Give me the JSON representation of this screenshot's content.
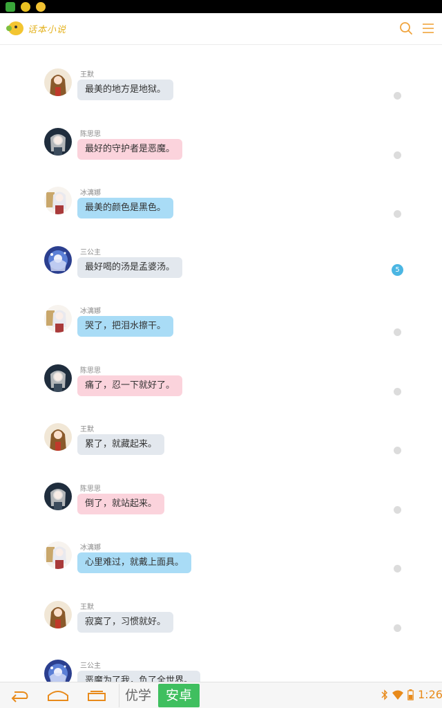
{
  "app": {
    "logo_text": "话本小说",
    "accent_color": "#f0a33b"
  },
  "header": {
    "icons": [
      "search-icon",
      "menu-icon"
    ]
  },
  "messages": [
    {
      "name": "王默",
      "text": "最美的地方是地狱。",
      "bubble_color": "gray",
      "avatar": "wangmo"
    },
    {
      "name": "陈思思",
      "text": "最好的守护者是恶魔。",
      "bubble_color": "pink",
      "avatar": "chensisi"
    },
    {
      "name": "冰漓娜",
      "text": "最美的颜色是黑色。",
      "bubble_color": "blue",
      "avatar": "binglina"
    },
    {
      "name": "三公主",
      "text": "最好喝的汤是孟婆汤。",
      "bubble_color": "gray",
      "avatar": "sangongzhu",
      "badge": "5"
    },
    {
      "name": "冰漓娜",
      "text": "哭了，把泪水擦干。",
      "bubble_color": "blue",
      "avatar": "binglina"
    },
    {
      "name": "陈思思",
      "text": "痛了，忍一下就好了。",
      "bubble_color": "pink",
      "avatar": "chensisi"
    },
    {
      "name": "王默",
      "text": "累了，就藏起来。",
      "bubble_color": "gray",
      "avatar": "wangmo"
    },
    {
      "name": "陈思思",
      "text": "倒了，就站起来。",
      "bubble_color": "pink",
      "avatar": "chensisi"
    },
    {
      "name": "冰漓娜",
      "text": "心里难过，就戴上面具。",
      "bubble_color": "blue",
      "avatar": "binglina"
    },
    {
      "name": "王默",
      "text": "寂寞了，习惯就好。",
      "bubble_color": "gray",
      "avatar": "wangmo"
    },
    {
      "name": "三公主",
      "text": "恶魔为了我，负了全世界。",
      "bubble_color": "gray",
      "avatar": "sangongzhu"
    }
  ],
  "navbar": {
    "youxue_label": "优学",
    "anzhuo_label": "安卓",
    "time": "1:26"
  }
}
